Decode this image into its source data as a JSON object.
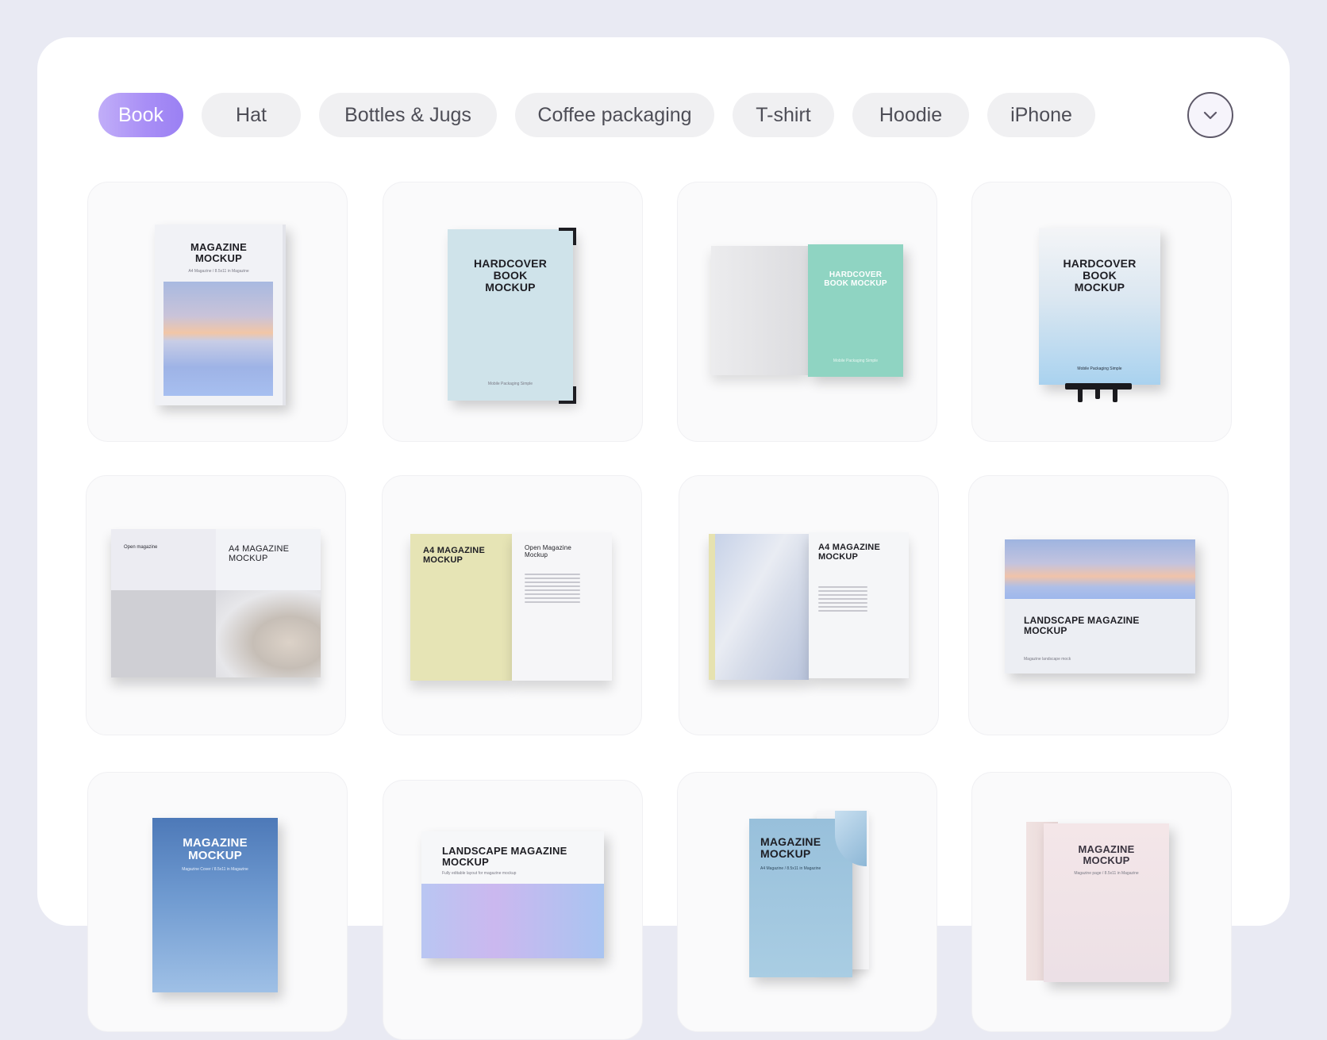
{
  "categories": {
    "items": [
      "Book",
      "Hat",
      "Bottles & Jugs",
      "Coffee packaging",
      "T-shirt",
      "Hoodie",
      "iPhone"
    ],
    "active": "Book",
    "expand_icon": "chevron-down-icon"
  },
  "cards": [
    {
      "title": "MAGAZINE MOCKUP",
      "caption": "A4 Magazine / 8.5x11 in Magazine"
    },
    {
      "title": "HARDCOVER BOOK MOCKUP",
      "caption": "Mobile Packaging Simple"
    },
    {
      "title": "HARDCOVER BOOK MOCKUP",
      "caption": "Mobile Packaging Simple"
    },
    {
      "title": "HARDCOVER BOOK MOCKUP",
      "caption": "Mobile Packaging Simple"
    },
    {
      "title": "A4 MAGAZINE MOCKUP",
      "caption": "Open magazine"
    },
    {
      "title": "A4 MAGAZINE MOCKUP",
      "caption": "Open Magazine Mockup"
    },
    {
      "title": "A4 MAGAZINE MOCKUP",
      "caption": "Title magazine / 8.5x11 in magazine"
    },
    {
      "title": "LANDSCAPE MAGAZINE MOCKUP",
      "caption": "Magazine landscape mock"
    },
    {
      "title": "MAGAZINE MOCKUP",
      "caption": "Magazine Cover / 8.5x11 in Magazine"
    },
    {
      "title": "LANDSCAPE MAGAZINE MOCKUP",
      "caption": "Fully editable layout for magazine mockup"
    },
    {
      "title": "MAGAZINE MOCKUP",
      "caption": "A4 Magazine / 8.5x11 in Magazine"
    },
    {
      "title": "MAGAZINE MOCKUP",
      "caption": "Magazine page / 8.5x11 in Magazine"
    }
  ],
  "colors": {
    "page_background": "#e9eaf3",
    "panel": "#ffffff",
    "accent_gradient_start": "#c1aef8",
    "accent_gradient_end": "#9a80f3",
    "pill_background": "#f0f0f2"
  }
}
